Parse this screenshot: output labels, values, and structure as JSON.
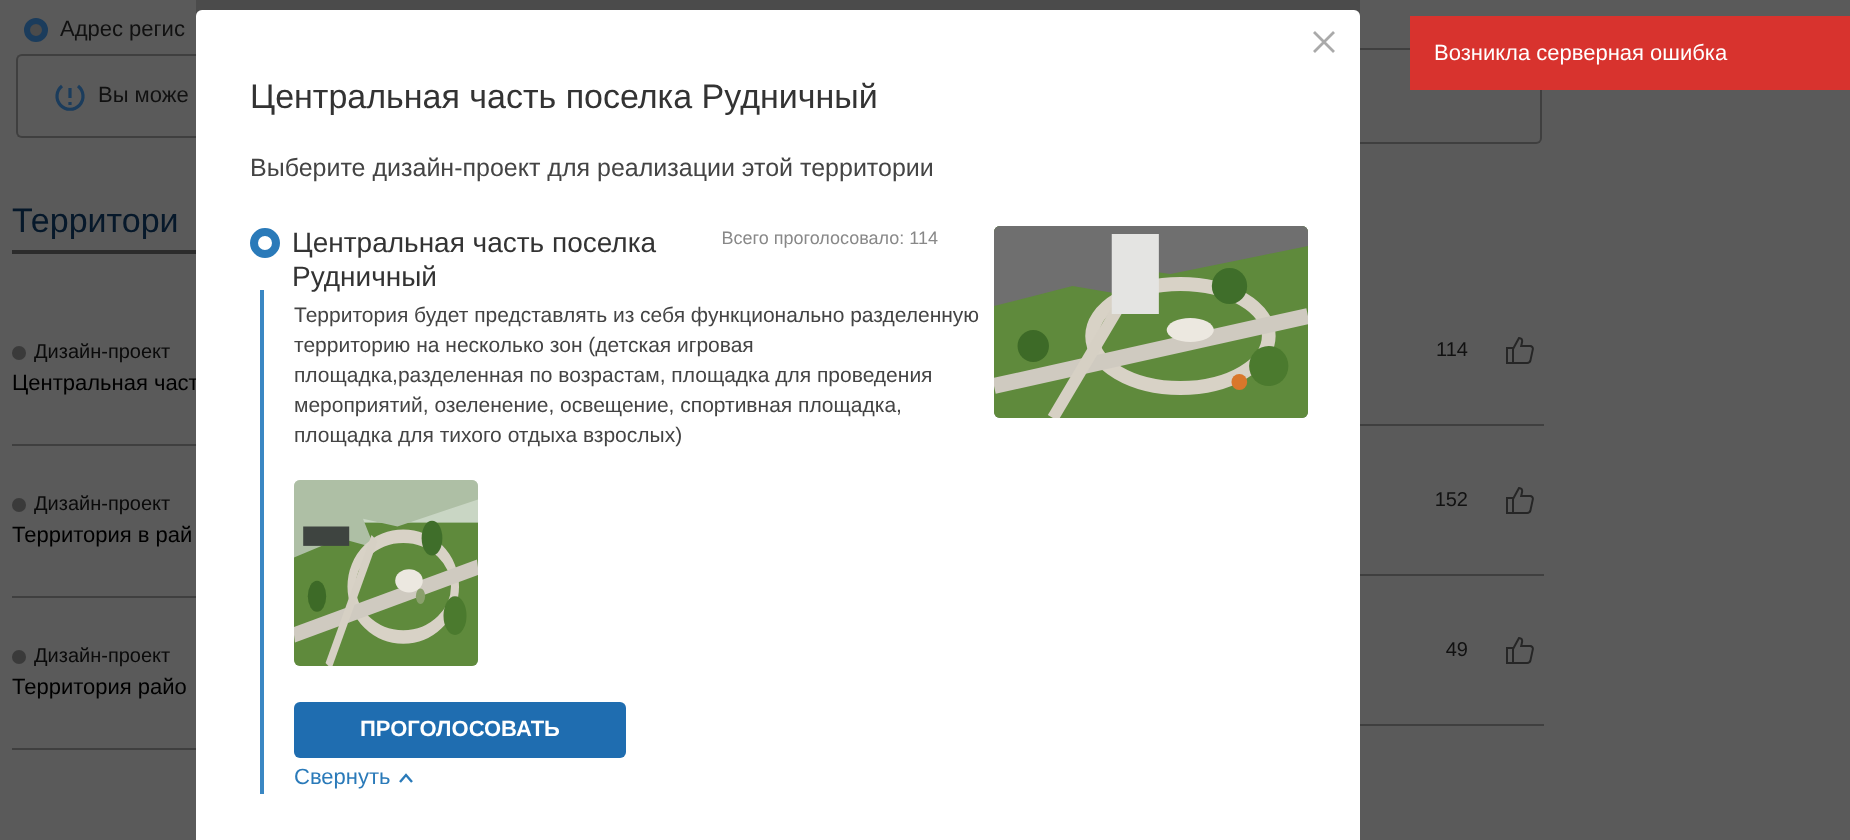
{
  "background": {
    "address": "Адрес регис",
    "notice": "Вы може",
    "section_title": "Территори",
    "projects": [
      {
        "category": "Дизайн-проект",
        "title": "Центральная част",
        "votes": "114"
      },
      {
        "category": "Дизайн-проект",
        "title": "Территория в рай",
        "votes": "152"
      },
      {
        "category": "Дизайн-проект",
        "title": "Территория райо",
        "votes": "49"
      }
    ]
  },
  "modal": {
    "title": "Центральная часть поселка Рудничный",
    "subtitle": "Выберите дизайн-проект для реализации этой территории",
    "option": {
      "selected": true,
      "title": "Центральная часть поселка Рудничный",
      "vote_total": "Всего проголосовало: 114",
      "description": "Территория будет представлять из себя функционально разделенную территорию на несколько зон (детская игровая площадка,разделенная по возрастам, площадка для проведения мероприятий, озеленение, освещение, спортивная площадка, площадка для тихого отдыха взрослых)"
    },
    "vote_button": "ПРОГОЛОСОВАТЬ",
    "collapse_link": "Свернуть"
  },
  "toast": {
    "message": "Возникла серверная ошибка"
  }
}
